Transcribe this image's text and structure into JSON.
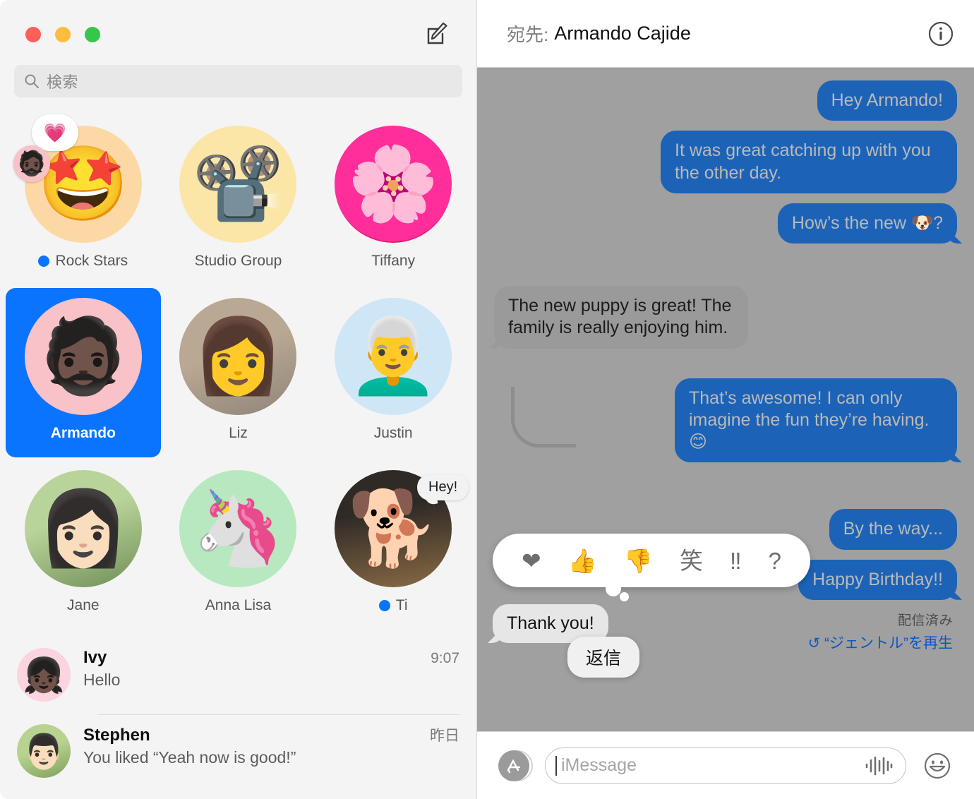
{
  "window": {
    "traffic_lights": [
      "close",
      "minimize",
      "zoom"
    ],
    "compose_icon": "compose-icon"
  },
  "sidebar": {
    "search": {
      "placeholder": "検索",
      "icon": "search-icon"
    },
    "pinned": [
      {
        "name": "Rock Stars",
        "avatar_emoji": "🤩",
        "avatar_bg": "#fcd9a4",
        "unread": true,
        "tapback": {
          "reaction": "❤️",
          "avatar_emoji": "🧔🏿",
          "avatar_bg": "#f8c2c8"
        }
      },
      {
        "name": "Studio Group",
        "avatar_emoji": "📽️",
        "avatar_bg": "#fbe6a8",
        "unread": false
      },
      {
        "name": "Tiffany",
        "avatar_emoji": "🌸",
        "avatar_bg": "#e8186f",
        "unread": false
      },
      {
        "name": "Armando",
        "avatar_emoji": "🧔🏿",
        "avatar_bg": "#f8c2c8",
        "unread": false,
        "selected": true
      },
      {
        "name": "Liz",
        "avatar_emoji": "👩",
        "avatar_bg": "#cbb9a6",
        "unread": false
      },
      {
        "name": "Justin",
        "avatar_emoji": "👨‍🦳",
        "avatar_bg": "#cfe6f7",
        "unread": false
      },
      {
        "name": "Jane",
        "avatar_emoji": "👩🏻",
        "avatar_bg": "#cfe0b4",
        "unread": false
      },
      {
        "name": "Anna Lisa",
        "avatar_emoji": "🦄",
        "avatar_bg": "#b7e8bf",
        "unread": false
      },
      {
        "name": "Ti",
        "avatar_emoji": "🐕",
        "avatar_bg": "#5a4638",
        "unread": true,
        "preview": "Hey!"
      }
    ],
    "conversations": [
      {
        "name": "Ivy",
        "time": "9:07",
        "snippet": "Hello",
        "avatar_emoji": "👧🏿",
        "avatar_bg": "#fbd4e0"
      },
      {
        "name": "Stephen",
        "time": "昨日",
        "snippet": "You liked “Yeah now is good!”",
        "avatar_emoji": "👨🏻",
        "avatar_bg": "#a8c98a"
      }
    ]
  },
  "conversation": {
    "to_label": "宛先:",
    "recipient": "Armando Cajide",
    "info_icon": "info-icon",
    "messages": [
      {
        "text": "Hey Armando!",
        "side": "out",
        "tail": false
      },
      {
        "text": "It was great catching up with you the other day.",
        "side": "out",
        "tail": false
      },
      {
        "text": "How’s the new 🐶?",
        "side": "out",
        "tail": true
      },
      {
        "text": "The new puppy is great! The family is really enjoying him.",
        "side": "in",
        "tail": true
      },
      {
        "text": "That’s awesome! I can only imagine the fun they’re having. 😊",
        "side": "out",
        "tail": true
      },
      {
        "text": "By the way...",
        "side": "out",
        "tail": false
      },
      {
        "text": "Happy Birthday!!",
        "side": "out",
        "tail": true
      }
    ],
    "delivered_label": "配信済み",
    "replay_label": "↺ “ジェントル”を再生",
    "tapbacks": [
      {
        "icon": "❤",
        "name": "heart"
      },
      {
        "icon": "👍",
        "name": "thumbs-up"
      },
      {
        "icon": "👎",
        "name": "thumbs-down"
      },
      {
        "icon": "笑",
        "name": "haha"
      },
      {
        "icon": "‼",
        "name": "exclamation"
      },
      {
        "icon": "?",
        "name": "question"
      }
    ],
    "focused_message": "Thank you!",
    "context_menu": {
      "reply_label": "返信"
    }
  },
  "composer": {
    "appstore_icon": "appstore-icon",
    "placeholder": "iMessage",
    "audio_icon": "audio-waveform-icon",
    "emoji_icon": "smiley-icon"
  },
  "colors": {
    "accent_blue": "#0b74ff",
    "bubble_out": "#1c63b8",
    "bubble_in": "#9a9a9a",
    "dim_overlay": "#a0a0a0",
    "link_blue": "#0b57c8"
  }
}
